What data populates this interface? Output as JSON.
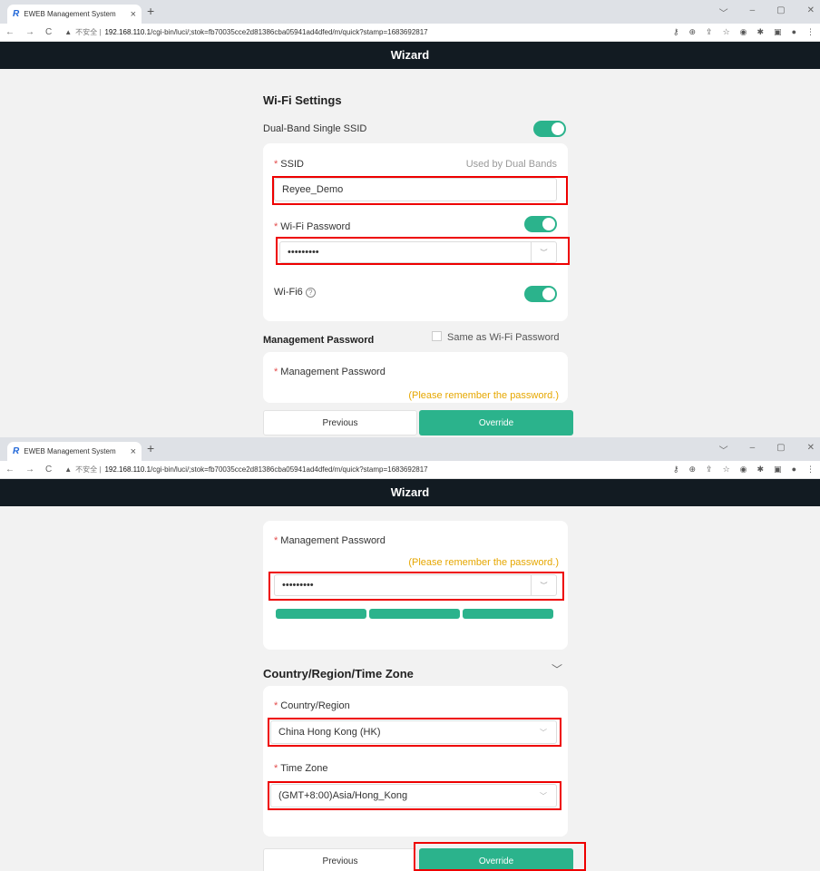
{
  "browser": {
    "tab_title": "EWEB Management System",
    "tab_close": "×",
    "new_tab": "+",
    "back": "←",
    "forward": "→",
    "reload": "C",
    "warning_icon": "▲",
    "insecure_label": "不安全 |",
    "url_host": "192.168.110.1",
    "url_path": "/cgi-bin/luci/;stok=fb70035cce2d81386cba05941ad4dfed/m/quick?stamp=1683692817",
    "window_controls": [
      "﹀",
      "–",
      "▢",
      "✕"
    ],
    "toolbar_icons": [
      "⚷",
      "⊕",
      "⇪",
      "☆",
      "◉",
      "✱",
      "▣",
      "●",
      "⋮"
    ]
  },
  "header": {
    "title": "Wizard"
  },
  "wifi": {
    "section_title": "Wi-Fi Settings",
    "dual_band_label": "Dual-Band Single SSID",
    "ssid_label": "SSID",
    "ssid_hint": "Used by Dual Bands",
    "ssid_value": "Reyee_Demo",
    "password_label": "Wi-Fi Password",
    "password_value": "•••••••••",
    "wifi6_label": "Wi-Fi6",
    "wifi6_help": "?"
  },
  "mgmt": {
    "section_title": "Management Password",
    "same_as_label": "Same as Wi-Fi Password",
    "field_label": "Management Password",
    "reminder": "(Please remember the password.)",
    "password_value": "•••••••••"
  },
  "region": {
    "section_title": "Country/Region/Time Zone",
    "country_label": "Country/Region",
    "country_value": "China Hong Kong (HK)",
    "timezone_label": "Time Zone",
    "timezone_value": "(GMT+8:00)Asia/Hong_Kong"
  },
  "buttons": {
    "previous": "Previous",
    "override": "Override"
  },
  "colors": {
    "accent": "#2bb38c",
    "header_bg": "#121b22",
    "highlight": "#e00000",
    "warning": "#e6a700"
  }
}
